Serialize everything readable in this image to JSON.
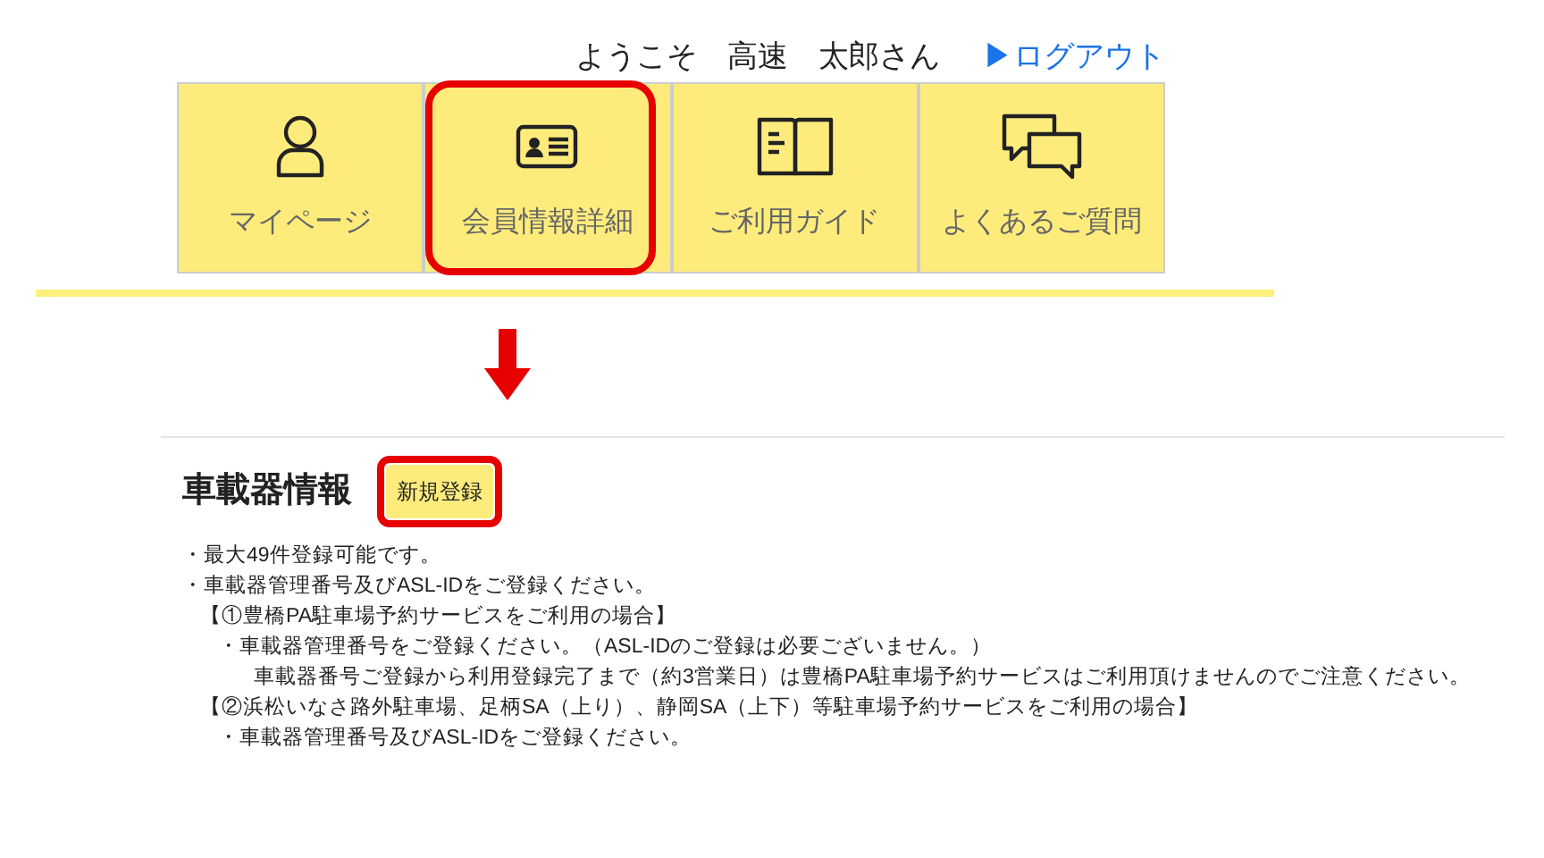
{
  "header": {
    "welcome": "ようこそ　高速　太郎さん",
    "logout": "▶ログアウト"
  },
  "nav": [
    {
      "label": "マイページ",
      "kind": "person",
      "highlighted": false
    },
    {
      "label": "会員情報詳細",
      "kind": "card",
      "highlighted": true
    },
    {
      "label": "ご利用ガイド",
      "kind": "book",
      "highlighted": false
    },
    {
      "label": "よくあるご質問",
      "kind": "chat",
      "highlighted": false
    }
  ],
  "section": {
    "title": "車載器情報",
    "button": {
      "label": "新規登録",
      "highlighted": true
    }
  },
  "notes": [
    {
      "kind": "bullet",
      "text": "・最大49件登録可能です。"
    },
    {
      "kind": "bullet",
      "text": "・車載器管理番号及びASL-IDをご登録ください。",
      "children": [
        {
          "kind": "heading",
          "text": "【①豊橋PA駐車場予約サービスをご利用の場合】",
          "children": [
            {
              "kind": "bullet",
              "text": "・車載器管理番号をご登録ください。（ASL-IDのご登録は必要ございません。）",
              "children": [
                {
                  "kind": "text",
                  "text": "車載器番号ご登録から利用登録完了まで（約3営業日）は豊橋PA駐車場予約サービスはご利用頂けませんのでご注意ください。"
                }
              ]
            }
          ]
        },
        {
          "kind": "heading",
          "text": "【②浜松いなさ路外駐車場、足柄SA（上り）、静岡SA（上下）等駐車場予約サービスをご利用の場合】",
          "children": [
            {
              "kind": "bullet",
              "text": "・車載器管理番号及びASL-IDをご登録ください。"
            }
          ]
        }
      ]
    }
  ]
}
